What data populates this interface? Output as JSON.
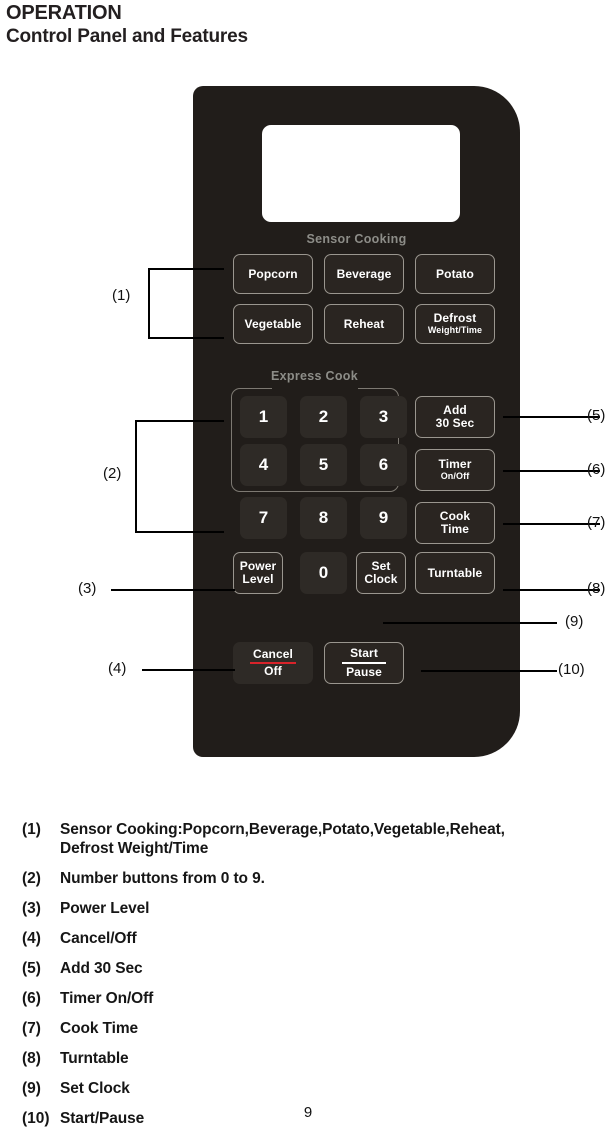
{
  "header": {
    "title": "OPERATION",
    "subtitle": "Control Panel and Features"
  },
  "panel": {
    "display_value": "",
    "sections": {
      "sensor_cooking": "Sensor Cooking",
      "express_cook": "Express Cook"
    },
    "sensor_buttons": [
      {
        "label": "Popcorn",
        "sub": ""
      },
      {
        "label": "Beverage",
        "sub": ""
      },
      {
        "label": "Potato",
        "sub": ""
      },
      {
        "label": "Vegetable",
        "sub": ""
      },
      {
        "label": "Reheat",
        "sub": ""
      },
      {
        "label": "Defrost",
        "sub": "Weight/Time"
      }
    ],
    "number_keys": [
      "1",
      "2",
      "3",
      "4",
      "5",
      "6",
      "7",
      "8",
      "9",
      "0"
    ],
    "function_buttons": {
      "power_level_l1": "Power",
      "power_level_l2": "Level",
      "set_clock_l1": "Set",
      "set_clock_l2": "Clock",
      "add_30_sec_l1": "Add",
      "add_30_sec_l2": "30 Sec",
      "timer_l1": "Timer",
      "timer_l2": "On/Off",
      "cook_time_l1": "Cook",
      "cook_time_l2": "Time",
      "turntable": "Turntable",
      "cancel_l1": "Cancel",
      "cancel_l2": "Off",
      "start_l1": "Start",
      "start_l2": "Pause"
    },
    "colors": {
      "panel_background": "#211d1a",
      "button_fill": "#2e2a26",
      "button_outline": "#9a968f",
      "section_label": "#8d8d88",
      "cancel_rule": "#d8232a",
      "display": "#ffffff"
    }
  },
  "callouts": {
    "c1": "(1)",
    "c2": "(2)",
    "c3": "(3)",
    "c4": "(4)",
    "c5": "(5)",
    "c6": "(6)",
    "c7": "(7)",
    "c8": "(8)",
    "c9": "(9)",
    "c10": "(10)"
  },
  "legend": [
    {
      "index": "(1)",
      "text": "Sensor Cooking:Popcorn,Beverage,Potato,Vegetable,Reheat,",
      "cont": "Defrost Weight/Time"
    },
    {
      "index": "(2)",
      "text": "Number buttons from 0 to 9.",
      "cont": ""
    },
    {
      "index": "(3)",
      "text": "Power Level",
      "cont": ""
    },
    {
      "index": "(4)",
      "text": "Cancel/Off",
      "cont": ""
    },
    {
      "index": "(5)",
      "text": "Add 30 Sec",
      "cont": ""
    },
    {
      "index": "(6)",
      "text": "Timer On/Off",
      "cont": ""
    },
    {
      "index": "(7)",
      "text": "Cook Time",
      "cont": ""
    },
    {
      "index": "(8)",
      "text": "Turntable",
      "cont": ""
    },
    {
      "index": "(9)",
      "text": "Set Clock",
      "cont": ""
    },
    {
      "index": "(10)",
      "text": "Start/Pause",
      "cont": ""
    }
  ],
  "footer": {
    "page_number": "9"
  }
}
